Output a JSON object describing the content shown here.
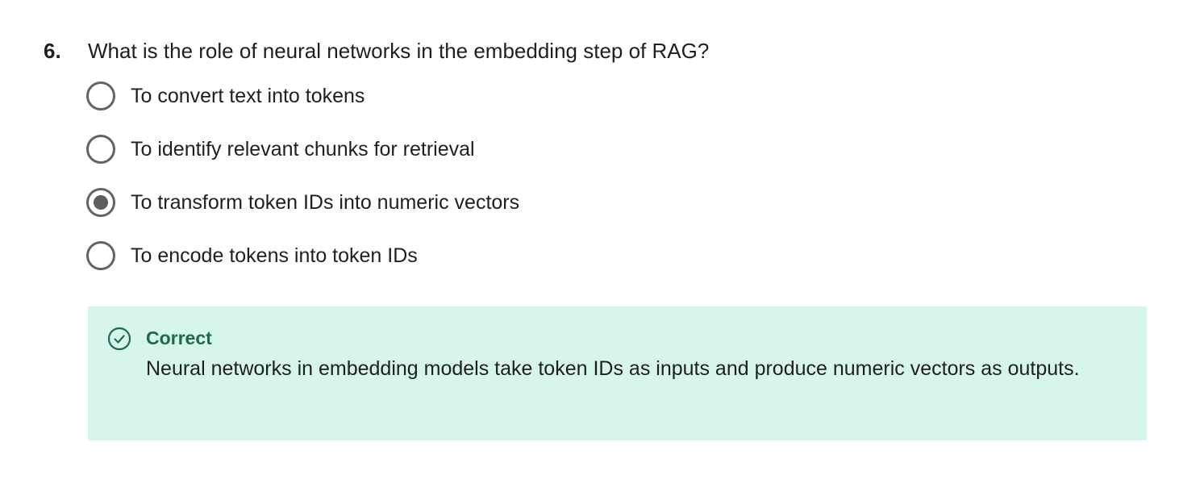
{
  "question": {
    "number": "6.",
    "text": "What is the role of neural networks in the embedding step of RAG?",
    "options": [
      {
        "label": "To convert text into tokens",
        "selected": false
      },
      {
        "label": "To identify relevant chunks for retrieval",
        "selected": false
      },
      {
        "label": "To transform token IDs into numeric vectors",
        "selected": true
      },
      {
        "label": "To encode tokens into token IDs",
        "selected": false
      }
    ]
  },
  "feedback": {
    "status": "Correct",
    "icon": "check-circle-icon",
    "message": "Neural networks in embedding models take token IDs as inputs and produce numeric vectors as outputs.",
    "background_color": "#d6f6ec",
    "accent_color": "#1f6b47"
  }
}
